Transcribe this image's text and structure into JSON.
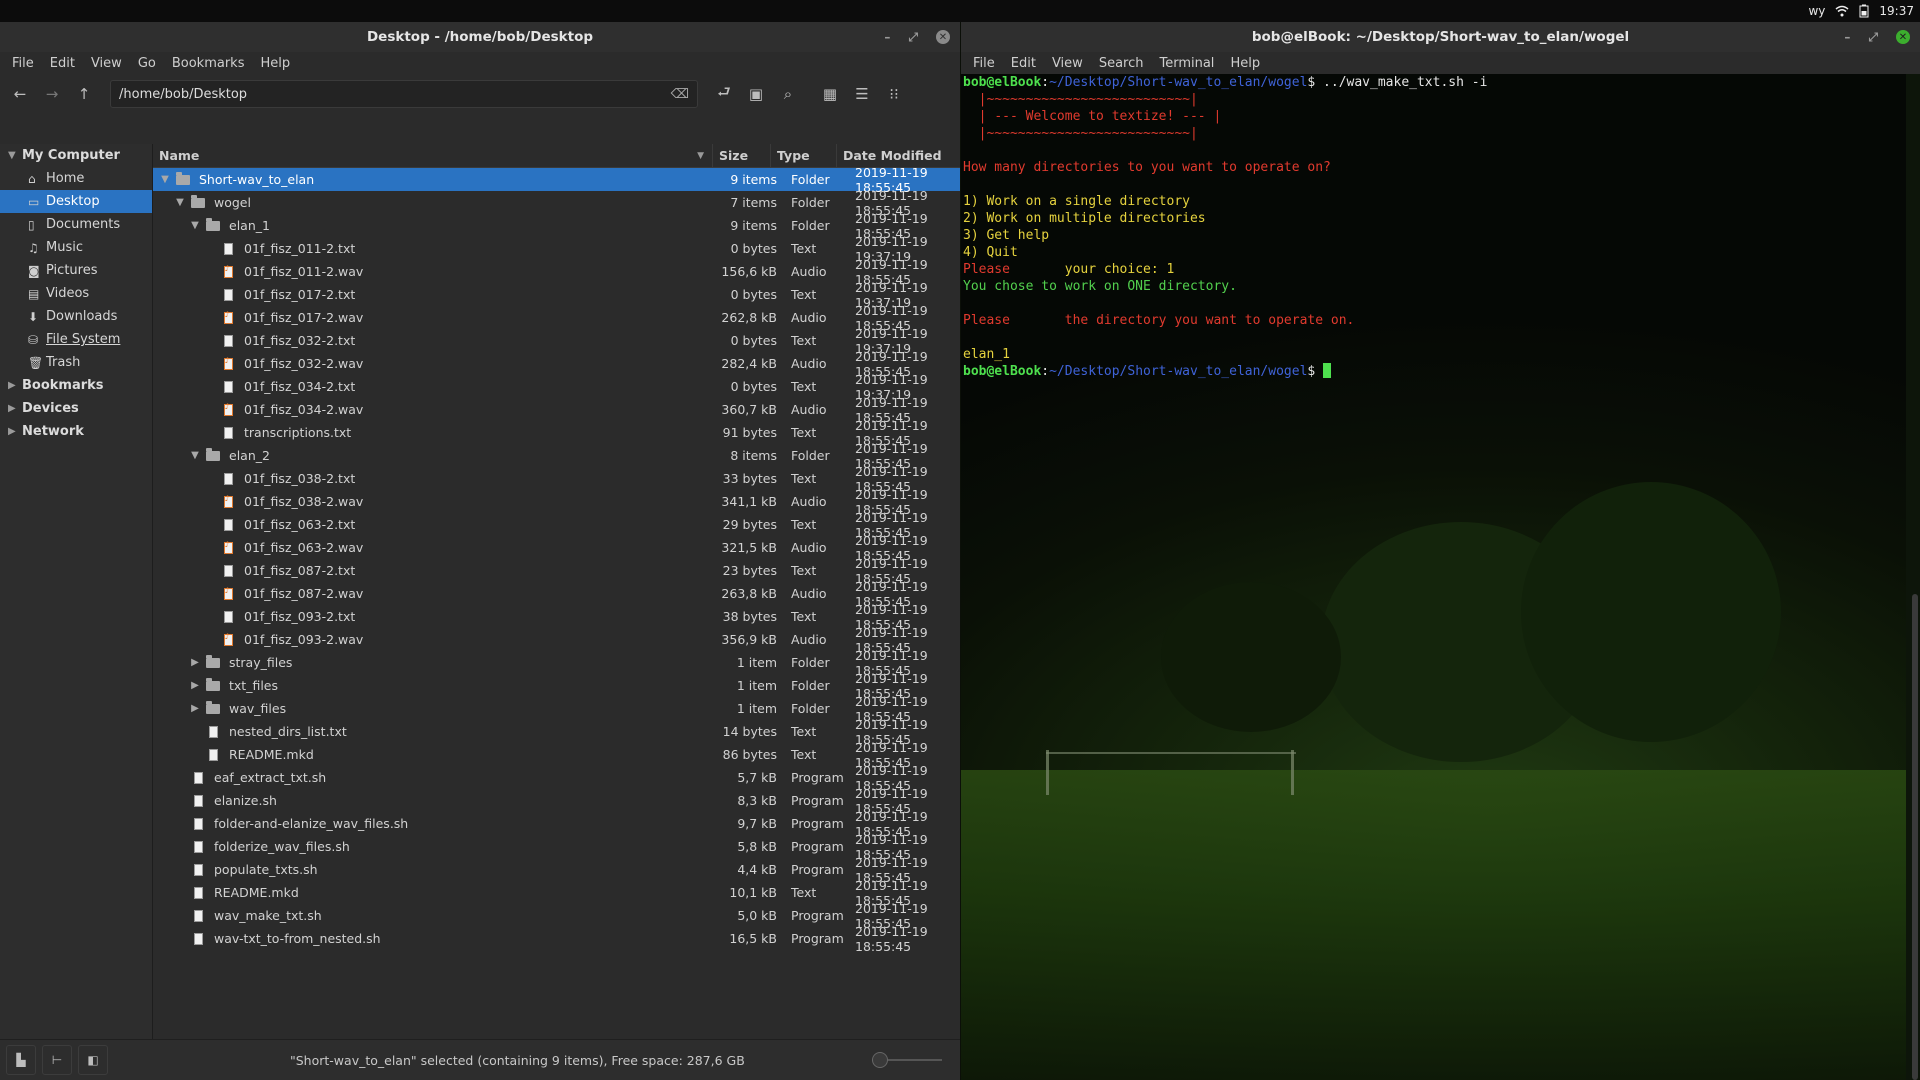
{
  "top_panel": {
    "tray": [
      "wy"
    ],
    "time": "19:37"
  },
  "file_manager": {
    "title": "Desktop - /home/bob/Desktop",
    "menu": [
      "File",
      "Edit",
      "View",
      "Go",
      "Bookmarks",
      "Help"
    ],
    "location": "/home/bob/Desktop",
    "sidebar": {
      "my_computer": "My Computer",
      "items": [
        {
          "label": "Home",
          "icon": "home-icon"
        },
        {
          "label": "Desktop",
          "icon": "desktop-icon",
          "selected": true
        },
        {
          "label": "Documents",
          "icon": "documents-icon"
        },
        {
          "label": "Music",
          "icon": "music-icon"
        },
        {
          "label": "Pictures",
          "icon": "pictures-icon"
        },
        {
          "label": "Videos",
          "icon": "videos-icon"
        },
        {
          "label": "Downloads",
          "icon": "downloads-icon"
        },
        {
          "label": "File System",
          "icon": "filesystem-icon"
        },
        {
          "label": "Trash",
          "icon": "trash-icon"
        }
      ],
      "sections": [
        "Bookmarks",
        "Devices",
        "Network"
      ]
    },
    "columns": {
      "name": "Name",
      "size": "Size",
      "type": "Type",
      "date": "Date Modified"
    },
    "rows": [
      {
        "depth": 0,
        "exp": "open",
        "icon": "folder",
        "name": "Short-wav_to_elan",
        "size": "9 items",
        "type": "Folder",
        "date": "2019-11-19 18:55:45",
        "selected": true
      },
      {
        "depth": 1,
        "exp": "open",
        "icon": "folder",
        "name": "wogel",
        "size": "7 items",
        "type": "Folder",
        "date": "2019-11-19 18:55:45"
      },
      {
        "depth": 2,
        "exp": "open",
        "icon": "folder",
        "name": "elan_1",
        "size": "9 items",
        "type": "Folder",
        "date": "2019-11-19 18:55:45"
      },
      {
        "depth": 3,
        "icon": "doc",
        "name": "01f_fisz_011-2.txt",
        "size": "0 bytes",
        "type": "Text",
        "date": "2019-11-19 19:37:19"
      },
      {
        "depth": 3,
        "icon": "audio",
        "name": "01f_fisz_011-2.wav",
        "size": "156,6 kB",
        "type": "Audio",
        "date": "2019-11-19 18:55:45"
      },
      {
        "depth": 3,
        "icon": "doc",
        "name": "01f_fisz_017-2.txt",
        "size": "0 bytes",
        "type": "Text",
        "date": "2019-11-19 19:37:19"
      },
      {
        "depth": 3,
        "icon": "audio",
        "name": "01f_fisz_017-2.wav",
        "size": "262,8 kB",
        "type": "Audio",
        "date": "2019-11-19 18:55:45"
      },
      {
        "depth": 3,
        "icon": "doc",
        "name": "01f_fisz_032-2.txt",
        "size": "0 bytes",
        "type": "Text",
        "date": "2019-11-19 19:37:19"
      },
      {
        "depth": 3,
        "icon": "audio",
        "name": "01f_fisz_032-2.wav",
        "size": "282,4 kB",
        "type": "Audio",
        "date": "2019-11-19 18:55:45"
      },
      {
        "depth": 3,
        "icon": "doc",
        "name": "01f_fisz_034-2.txt",
        "size": "0 bytes",
        "type": "Text",
        "date": "2019-11-19 19:37:19"
      },
      {
        "depth": 3,
        "icon": "audio",
        "name": "01f_fisz_034-2.wav",
        "size": "360,7 kB",
        "type": "Audio",
        "date": "2019-11-19 18:55:45"
      },
      {
        "depth": 3,
        "icon": "doc",
        "name": "transcriptions.txt",
        "size": "91 bytes",
        "type": "Text",
        "date": "2019-11-19 18:55:45"
      },
      {
        "depth": 2,
        "exp": "open",
        "icon": "folder",
        "name": "elan_2",
        "size": "8 items",
        "type": "Folder",
        "date": "2019-11-19 18:55:45"
      },
      {
        "depth": 3,
        "icon": "doc",
        "name": "01f_fisz_038-2.txt",
        "size": "33 bytes",
        "type": "Text",
        "date": "2019-11-19 18:55:45"
      },
      {
        "depth": 3,
        "icon": "audio",
        "name": "01f_fisz_038-2.wav",
        "size": "341,1 kB",
        "type": "Audio",
        "date": "2019-11-19 18:55:45"
      },
      {
        "depth": 3,
        "icon": "doc",
        "name": "01f_fisz_063-2.txt",
        "size": "29 bytes",
        "type": "Text",
        "date": "2019-11-19 18:55:45"
      },
      {
        "depth": 3,
        "icon": "audio",
        "name": "01f_fisz_063-2.wav",
        "size": "321,5 kB",
        "type": "Audio",
        "date": "2019-11-19 18:55:45"
      },
      {
        "depth": 3,
        "icon": "doc",
        "name": "01f_fisz_087-2.txt",
        "size": "23 bytes",
        "type": "Text",
        "date": "2019-11-19 18:55:45"
      },
      {
        "depth": 3,
        "icon": "audio",
        "name": "01f_fisz_087-2.wav",
        "size": "263,8 kB",
        "type": "Audio",
        "date": "2019-11-19 18:55:45"
      },
      {
        "depth": 3,
        "icon": "doc",
        "name": "01f_fisz_093-2.txt",
        "size": "38 bytes",
        "type": "Text",
        "date": "2019-11-19 18:55:45"
      },
      {
        "depth": 3,
        "icon": "audio",
        "name": "01f_fisz_093-2.wav",
        "size": "356,9 kB",
        "type": "Audio",
        "date": "2019-11-19 18:55:45"
      },
      {
        "depth": 2,
        "exp": "closed",
        "icon": "folder",
        "name": "stray_files",
        "size": "1 item",
        "type": "Folder",
        "date": "2019-11-19 18:55:45"
      },
      {
        "depth": 2,
        "exp": "closed",
        "icon": "folder",
        "name": "txt_files",
        "size": "1 item",
        "type": "Folder",
        "date": "2019-11-19 18:55:45"
      },
      {
        "depth": 2,
        "exp": "closed",
        "icon": "folder",
        "name": "wav_files",
        "size": "1 item",
        "type": "Folder",
        "date": "2019-11-19 18:55:45"
      },
      {
        "depth": 2,
        "icon": "doc",
        "name": "nested_dirs_list.txt",
        "size": "14 bytes",
        "type": "Text",
        "date": "2019-11-19 18:55:45"
      },
      {
        "depth": 2,
        "icon": "doc",
        "name": "README.mkd",
        "size": "86 bytes",
        "type": "Text",
        "date": "2019-11-19 18:55:45"
      },
      {
        "depth": 1,
        "icon": "doc",
        "name": "eaf_extract_txt.sh",
        "size": "5,7 kB",
        "type": "Program",
        "date": "2019-11-19 18:55:45"
      },
      {
        "depth": 1,
        "icon": "doc",
        "name": "elanize.sh",
        "size": "8,3 kB",
        "type": "Program",
        "date": "2019-11-19 18:55:45"
      },
      {
        "depth": 1,
        "icon": "doc",
        "name": "folder-and-elanize_wav_files.sh",
        "size": "9,7 kB",
        "type": "Program",
        "date": "2019-11-19 18:55:45"
      },
      {
        "depth": 1,
        "icon": "doc",
        "name": "folderize_wav_files.sh",
        "size": "5,8 kB",
        "type": "Program",
        "date": "2019-11-19 18:55:45"
      },
      {
        "depth": 1,
        "icon": "doc",
        "name": "populate_txts.sh",
        "size": "4,4 kB",
        "type": "Program",
        "date": "2019-11-19 18:55:45"
      },
      {
        "depth": 1,
        "icon": "doc",
        "name": "README.mkd",
        "size": "10,1 kB",
        "type": "Text",
        "date": "2019-11-19 18:55:45"
      },
      {
        "depth": 1,
        "icon": "doc",
        "name": "wav_make_txt.sh",
        "size": "5,0 kB",
        "type": "Program",
        "date": "2019-11-19 18:55:45"
      },
      {
        "depth": 1,
        "icon": "doc",
        "name": "wav-txt_to-from_nested.sh",
        "size": "16,5 kB",
        "type": "Program",
        "date": "2019-11-19 18:55:45"
      }
    ],
    "status": "\"Short-wav_to_elan\" selected (containing 9 items), Free space: 287,6 GB"
  },
  "terminal": {
    "title": "bob@elBook: ~/Desktop/Short-wav_to_elan/wogel",
    "menu": [
      "File",
      "Edit",
      "View",
      "Search",
      "Terminal",
      "Help"
    ],
    "prompt_user": "bob@elBook",
    "prompt_path": "~/Desktop/Short-wav_to_elan/wogel",
    "command": "../wav_make_txt.sh -i",
    "banner_top": "~~~~~~~~~~~~~~~~~~~~~~~~~~",
    "banner": "--- Welcome to textize! ---",
    "banner_bottom": "~~~~~~~~~~~~~~~~~~~~~~~~~~",
    "question": "How many directories to you want to operate on?",
    "options": [
      "1) Work on a single directory",
      "2) Work on multiple directories",
      "3) Get help",
      "4) Quit"
    ],
    "choice_prefix": "Please",
    "choice_suffix": "your choice: 1",
    "chose": "You chose to work on ONE directory.",
    "dir_prefix": "Please",
    "dir_suffix": "the directory you want to operate on.",
    "answer": "elan_1"
  },
  "colors": {
    "selection": "#2a73c2",
    "prompt_green": "#4ee04e",
    "prompt_blue": "#3f63d8",
    "term_red": "#e13a2e",
    "term_yellow": "#e5d23e"
  }
}
